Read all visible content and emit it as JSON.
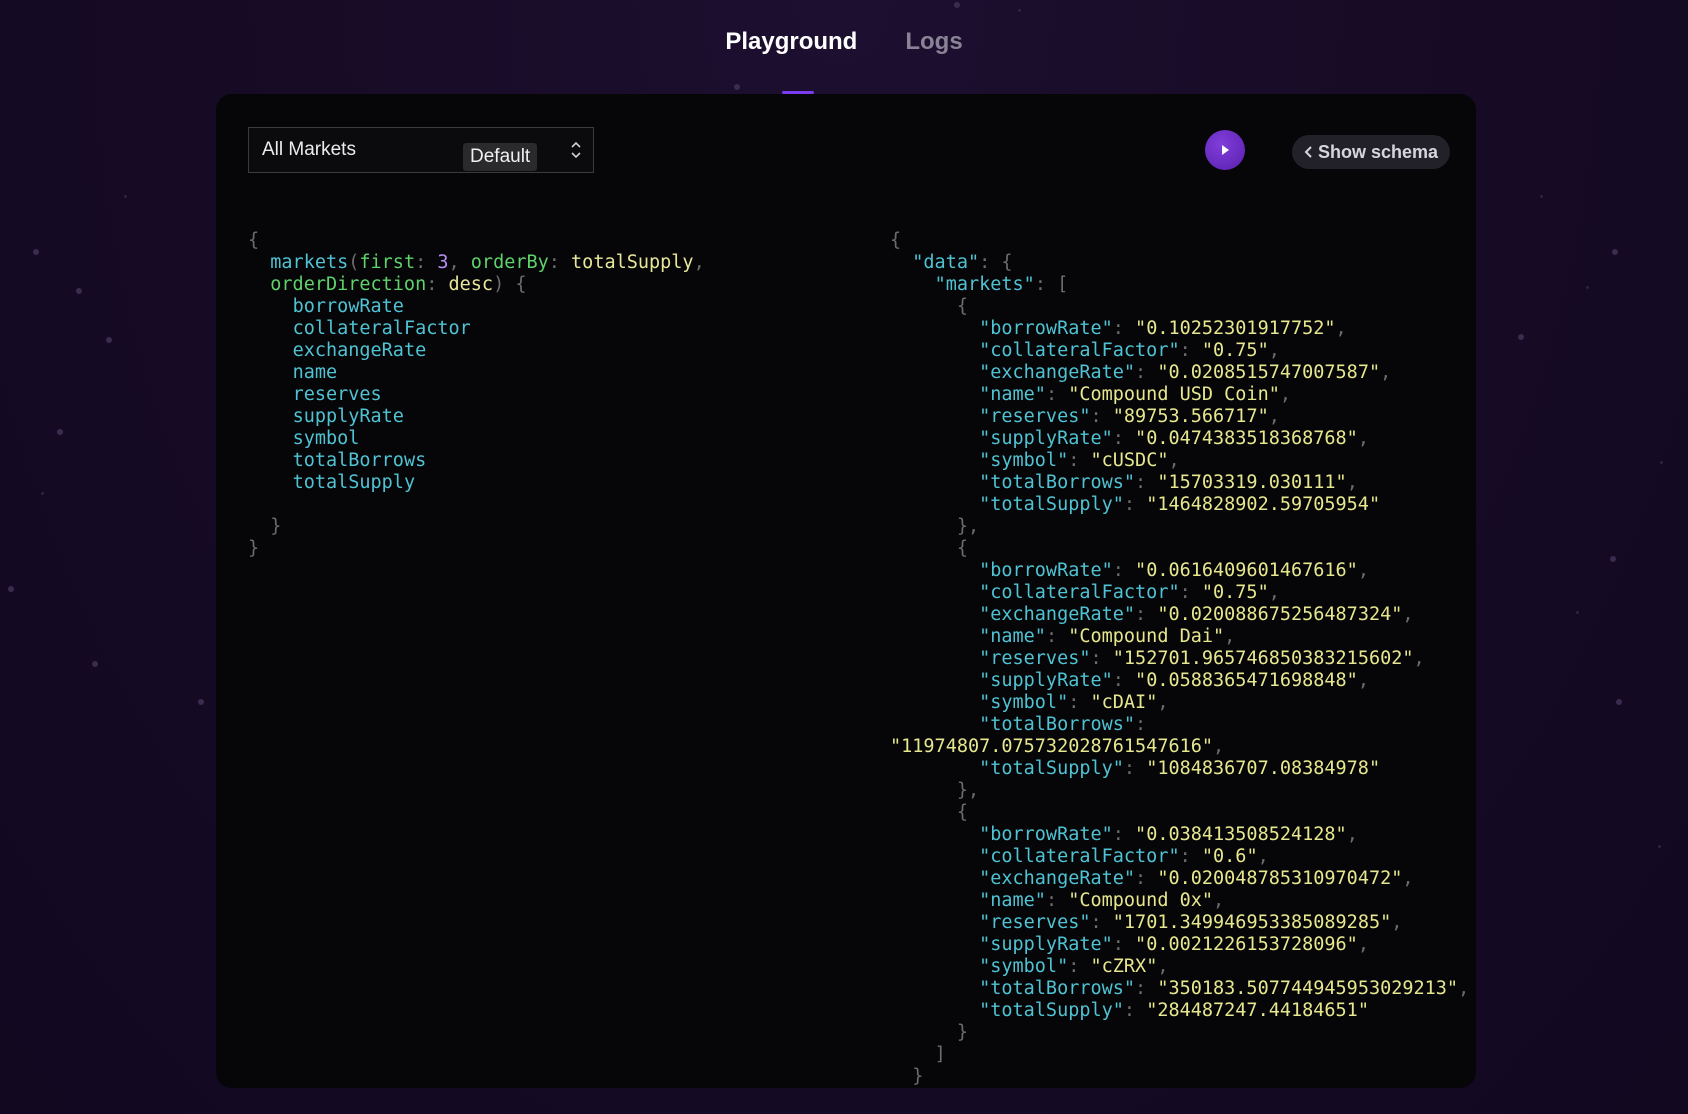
{
  "tabs": [
    {
      "label": "Playground",
      "active": true
    },
    {
      "label": "Logs",
      "active": false
    }
  ],
  "query_selector": {
    "label": "All Markets",
    "badge": "Default"
  },
  "run_button": {
    "icon": "play-icon"
  },
  "schema_button": {
    "label": "Show schema",
    "icon": "chevron-left-icon"
  },
  "query": {
    "root": "markets",
    "args": [
      {
        "name": "first",
        "value": "3"
      },
      {
        "name": "orderBy",
        "value": "totalSupply"
      },
      {
        "name": "orderDirection",
        "value": "desc"
      }
    ],
    "fields": [
      "borrowRate",
      "collateralFactor",
      "exchangeRate",
      "name",
      "reserves",
      "supplyRate",
      "symbol",
      "totalBorrows",
      "totalSupply"
    ]
  },
  "result": {
    "data_key": "data",
    "list_key": "markets",
    "markets": [
      {
        "borrowRate": "0.10252301917752",
        "collateralFactor": "0.75",
        "exchangeRate": "0.0208515747007587",
        "name": "Compound USD Coin",
        "reserves": "89753.566717",
        "supplyRate": "0.0474383518368768",
        "symbol": "cUSDC",
        "totalBorrows": "15703319.030111",
        "totalSupply": "1464828902.59705954"
      },
      {
        "borrowRate": "0.0616409601467616",
        "collateralFactor": "0.75",
        "exchangeRate": "0.020088675256487324",
        "name": "Compound Dai",
        "reserves": "152701.965746850383215602",
        "supplyRate": "0.0588365471698848",
        "symbol": "cDAI",
        "totalBorrows": "11974807.075732028761547616",
        "totalSupply": "1084836707.08384978"
      },
      {
        "borrowRate": "0.038413508524128",
        "collateralFactor": "0.6",
        "exchangeRate": "0.020048785310970472",
        "name": "Compound 0x",
        "reserves": "1701.349946953385089285",
        "supplyRate": "0.0021226153728096",
        "symbol": "cZRX",
        "totalBorrows": "350183.507744945953029213",
        "totalSupply": "284487247.44184651"
      }
    ]
  }
}
